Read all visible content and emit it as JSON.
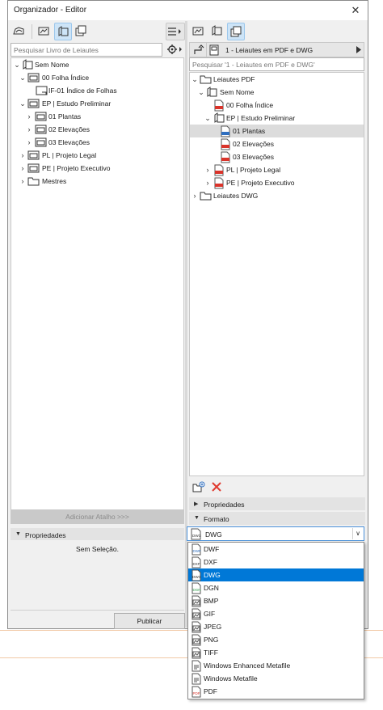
{
  "window": {
    "title": "Organizador - Editor",
    "close_glyph": "✕"
  },
  "left": {
    "search_placeholder": "Pesquisar Livro de Leiautes",
    "tree": [
      {
        "label": "Sem Nome",
        "icon": "book-icon"
      },
      {
        "label": "00 Folha Índice",
        "icon": "subset-folder-icon"
      },
      {
        "label": "IF-01 Índice de Folhas",
        "icon": "layout-icon"
      },
      {
        "label": "EP | Estudo Preliminar",
        "icon": "subset-folder-icon"
      },
      {
        "label": "01 Plantas",
        "icon": "subset-folder-icon"
      },
      {
        "label": "02 Elevações",
        "icon": "subset-folder-icon"
      },
      {
        "label": "03 Elevações",
        "icon": "subset-folder-icon"
      },
      {
        "label": "PL | Projeto Legal",
        "icon": "subset-folder-icon"
      },
      {
        "label": "PE | Projeto Executivo",
        "icon": "subset-folder-icon"
      },
      {
        "label": "Mestres",
        "icon": "folder-icon"
      }
    ],
    "add_shortcut_label": "Adicionar Atalho >>>",
    "properties_title": "Propriedades",
    "no_selection": "Sem Seleção.",
    "publish_label": "Publicar"
  },
  "right": {
    "publisher_set": "1 - Leiautes em PDF e DWG",
    "search_placeholder": "Pesquisar '1 - Leiautes em PDF e DWG'",
    "tree": [
      {
        "label": "Leiautes PDF",
        "icon": "folder-icon"
      },
      {
        "label": "Sem Nome",
        "icon": "book-icon"
      },
      {
        "label": "00 Folha Índice",
        "icon": "pdf-file-icon"
      },
      {
        "label": "EP | Estudo Preliminar",
        "icon": "book-icon"
      },
      {
        "label": "01 Plantas",
        "icon": "dwg-file-icon"
      },
      {
        "label": "02 Elevações",
        "icon": "pdf-file-icon"
      },
      {
        "label": "03 Elevações",
        "icon": "pdf-file-icon"
      },
      {
        "label": "PL | Projeto Legal",
        "icon": "pdf-file-icon"
      },
      {
        "label": "PE | Projeto Executivo",
        "icon": "pdf-file-icon"
      },
      {
        "label": "Leiautes DWG",
        "icon": "folder-icon"
      }
    ],
    "properties_title": "Propriedades",
    "format_title": "Formato",
    "format_value": "DWG",
    "format_options": [
      {
        "label": "DWF",
        "tag": "DWF"
      },
      {
        "label": "DXF",
        "tag": "DXF"
      },
      {
        "label": "DWG",
        "tag": "DWG"
      },
      {
        "label": "DGN",
        "tag": "DGN"
      },
      {
        "label": "BMP",
        "tag": ""
      },
      {
        "label": "GIF",
        "tag": ""
      },
      {
        "label": "JPEG",
        "tag": ""
      },
      {
        "label": "PNG",
        "tag": ""
      },
      {
        "label": "TIFF",
        "tag": ""
      },
      {
        "label": "Windows Enhanced Metafile",
        "tag": ""
      },
      {
        "label": "Windows Metafile",
        "tag": ""
      },
      {
        "label": "PDF",
        "tag": "PDF"
      }
    ]
  },
  "colors": {
    "selection": "#0078d7",
    "pdf_red": "#d9342b",
    "dwg_blue": "#2f6fc0",
    "dgn_green": "#2e9b4a",
    "delete_red": "#e03a2f"
  }
}
